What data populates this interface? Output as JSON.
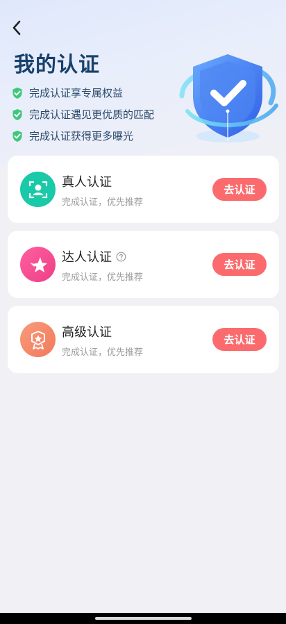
{
  "header": {
    "title": "我的认证",
    "benefits": [
      {
        "text": "完成认证享专属权益"
      },
      {
        "text": "完成认证遇见更优质的匹配"
      },
      {
        "text": "完成认证获得更多曝光"
      }
    ]
  },
  "cards": [
    {
      "title": "真人认证",
      "subtitle": "完成认证，优先推荐",
      "button": "去认证",
      "icon": "face-scan-icon",
      "color": "#19c9a8"
    },
    {
      "title": "达人认证",
      "subtitle": "完成认证，优先推荐",
      "button": "去认证",
      "icon": "star-icon",
      "color": "#f2508a"
    },
    {
      "title": "高级认证",
      "subtitle": "完成认证，优先推荐",
      "button": "去认证",
      "icon": "medal-icon",
      "color": "#f5896a"
    }
  ],
  "colors": {
    "accent_button": "#fb6b6e",
    "check_green": "#3fc87b",
    "title_blue": "#17406b"
  }
}
